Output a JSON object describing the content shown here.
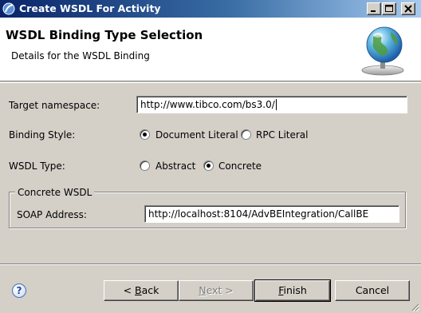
{
  "window": {
    "title": "Create WSDL For Activity"
  },
  "header": {
    "title": "WSDL Binding Type Selection",
    "subtitle": "Details for the WSDL Binding",
    "icon": "globe-service-icon"
  },
  "form": {
    "target_namespace": {
      "label": "Target namespace:",
      "value": "http://www.tibco.com/bs3.0/"
    },
    "binding_style": {
      "label": "Binding Style:",
      "options": [
        "Document Literal",
        "RPC Literal"
      ],
      "selected": "Document Literal"
    },
    "wsdl_type": {
      "label": "WSDL Type:",
      "options": [
        "Abstract",
        "Concrete"
      ],
      "selected": "Concrete"
    },
    "concrete_group": {
      "legend": "Concrete WSDL",
      "soap_address": {
        "label": "SOAP Address:",
        "value": "http://localhost:8104/AdvBEIntegration/CallBE"
      }
    }
  },
  "footer": {
    "help_symbol": "?",
    "back": {
      "mnemonic": "B",
      "rest": "ack",
      "prefix": "< ",
      "enabled": true
    },
    "next": {
      "mnemonic": "N",
      "rest": "ext >",
      "enabled": false
    },
    "finish": {
      "mnemonic": "F",
      "rest": "inish",
      "enabled": true,
      "default": true
    },
    "cancel": {
      "label": "Cancel",
      "enabled": true
    }
  }
}
